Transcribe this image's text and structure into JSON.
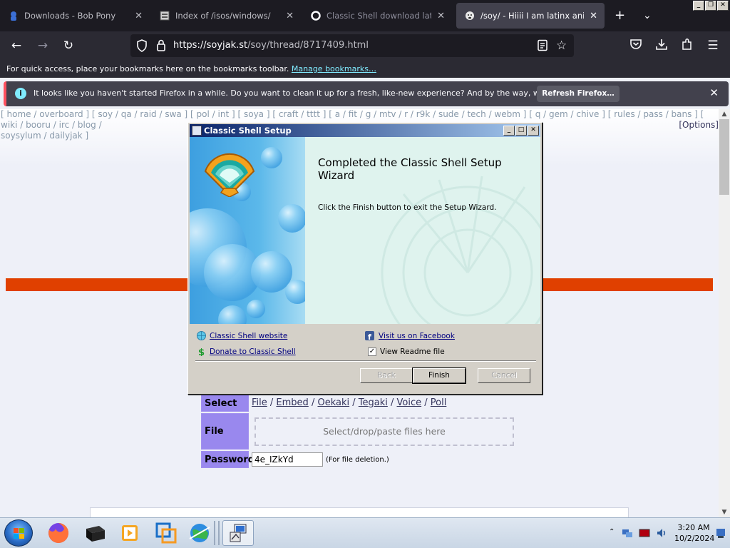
{
  "browser": {
    "tabs": [
      {
        "title": "Downloads - Bob Pony",
        "icon": "bob-pony-icon",
        "active": false
      },
      {
        "title": "Index of /isos/windows/",
        "icon": "server-icon",
        "active": false
      },
      {
        "title": "Classic Shell download latest ve",
        "icon": "circle-icon",
        "active": false
      },
      {
        "title": "/soy/ - Hiiii I am latinx anime fan",
        "icon": "soyjak-icon",
        "active": true
      }
    ],
    "url_host": "https://soyjak.st",
    "url_path": "/soy/thread/8717409.html",
    "bookmarks_text": "For quick access, place your bookmarks here on the bookmarks toolbar.",
    "bookmarks_link": "Manage bookmarks…",
    "notification_text": "It looks like you haven't started Firefox in a while. Do you want to clean it up for a fresh, like-new experience? And by the way, welcome back!",
    "notification_button": "Refresh Firefox…"
  },
  "page": {
    "boardlist_line1": "[ home / overboard ] [ soy / qa / raid / swa ] [ pol / int ] [ soya ] [ craft / tttt ] [ a / fit / g / mtv / r / r9k / sude / tech / webm ] [ q / gem / chive ] [ rules / pass / bans ] [ wiki / booru / irc / blog /",
    "boardlist_line2": "soysylum / dailyjak ]",
    "options": "[Options]",
    "form": {
      "select_label": "Select",
      "select_options": [
        "File",
        "Embed",
        "Oekaki",
        "Tegaki",
        "Voice",
        "Poll"
      ],
      "file_label": "File",
      "dropzone": "Select/drop/paste files here",
      "password_label": "Password",
      "password_value": "4e_IZkYd",
      "password_note": "(For file deletion.)"
    }
  },
  "dialog": {
    "title": "Classic Shell Setup",
    "heading": "Completed the Classic Shell Setup Wizard",
    "body": "Click the Finish button to exit the Setup Wizard.",
    "link_website": "Classic Shell website",
    "link_donate": "Donate to Classic Shell",
    "link_facebook": "Visit us on Facebook",
    "readme_label": "View Readme file",
    "readme_checked": true,
    "btn_back": "Back",
    "btn_finish": "Finish",
    "btn_cancel": "Cancel"
  },
  "taskbar": {
    "time": "3:20 AM",
    "date": "10/2/2024"
  }
}
